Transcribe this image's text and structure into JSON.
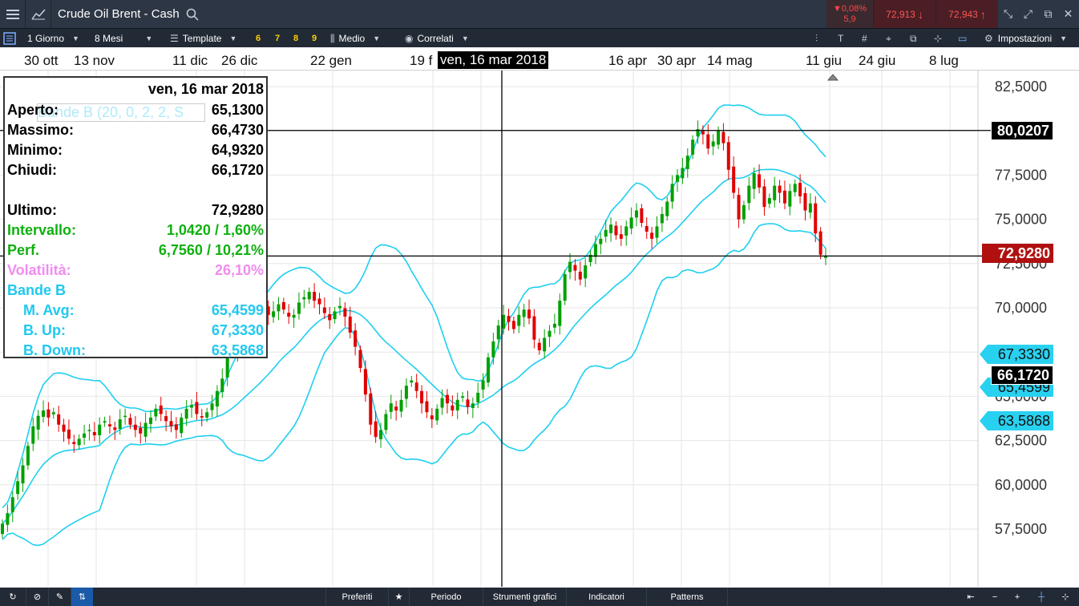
{
  "titlebar": {
    "instrument": "Crude Oil Brent - Cash",
    "change_pct": "▼0,08%",
    "change_pts": "5,9",
    "sell_price": "72,913",
    "buy_price": "72,943"
  },
  "toolbar": {
    "interval": "1 Giorno",
    "range": "8 Mesi",
    "template": "Template",
    "quick_buttons": [
      "6",
      "7",
      "8",
      "9"
    ],
    "chart_type": "Medio",
    "correlated": "Correlati",
    "settings": "Impostazioni"
  },
  "date_axis": {
    "labels": [
      "30 ott",
      "13 nov",
      "11 dic",
      "26 dic",
      "22 gen",
      "19 f",
      "16 apr",
      "30 apr",
      "14 mag",
      "11 giu",
      "24 giu",
      "8 lug"
    ],
    "cursor_date": "ven, 16 mar 2018"
  },
  "price_axis": {
    "ticks": [
      "82,5000",
      "77,5000",
      "75,0000",
      "72,5000",
      "70,0000",
      "65,0000",
      "62,5000",
      "60,0000",
      "57,5000"
    ]
  },
  "price_tags": {
    "cursor_high": "80,0207",
    "last": "72,9280",
    "band_up": "67,3330",
    "close": "66,1720",
    "mavg": "65,4599",
    "band_down": "63,5868"
  },
  "info_box": {
    "date": "ven, 16 mar 2018",
    "indicator_legend": "Bande B (20, 0, 2, 2, S",
    "open_label": "Aperto:",
    "open": "65,1300",
    "high_label": "Massimo:",
    "high": "66,4730",
    "low_label": "Minimo:",
    "low": "64,9320",
    "close_label": "Chiudi:",
    "close": "66,1720",
    "last_label": "Ultimo:",
    "last": "72,9280",
    "range_label": "Intervallo:",
    "range": "1,0420 / 1,60%",
    "perf_label": "Perf.",
    "perf": "6,7560 / 10,21%",
    "vol_label": "Volatilità:",
    "vol": "26,10%",
    "bb_label": "Bande B",
    "mavg_label": "M. Avg:",
    "mavg": "65,4599",
    "bup_label": "B. Up:",
    "bup": "67,3330",
    "bdown_label": "B. Down:",
    "bdown": "63,5868"
  },
  "bottom_bar": {
    "favorites": "Preferiti",
    "period": "Periodo",
    "tools": "Strumenti grafici",
    "indicators": "Indicatori",
    "patterns": "Patterns"
  },
  "colors": {
    "bull": "#00a000",
    "bear": "#e00000",
    "bands": "#1ecfef",
    "dark_bar": "#2d3644",
    "last_tag": "#b01010",
    "band_tag": "#29d1f0"
  },
  "chart_data": {
    "type": "candlestick",
    "ylim": [
      55.5,
      83.5
    ],
    "closes": [
      57.8,
      58.4,
      59.3,
      60.2,
      61.1,
      62.2,
      63.3,
      63.9,
      64.2,
      63.8,
      64.1,
      63.4,
      63.0,
      62.6,
      62.3,
      62.6,
      62.9,
      63.1,
      62.8,
      63.4,
      63.6,
      63.3,
      63.1,
      63.7,
      63.9,
      63.4,
      63.1,
      62.9,
      63.5,
      63.8,
      64.3,
      64.0,
      63.6,
      63.3,
      63.1,
      63.8,
      64.3,
      64.5,
      64.0,
      63.8,
      64.1,
      64.6,
      65.3,
      66.0,
      67.2,
      67.5,
      67.9,
      68.3,
      68.8,
      69.3,
      69.5,
      69.9,
      69.6,
      69.8,
      70.2,
      69.9,
      69.5,
      69.6,
      70.3,
      70.6,
      70.9,
      70.4,
      70.2,
      69.7,
      69.3,
      69.8,
      70.1,
      69.5,
      68.6,
      67.8,
      66.6,
      65.1,
      63.4,
      62.7,
      63.1,
      64.0,
      64.6,
      64.2,
      64.8,
      65.6,
      65.9,
      65.3,
      64.6,
      64.1,
      63.7,
      64.3,
      64.9,
      64.6,
      64.2,
      64.8,
      65.0,
      64.4,
      64.6,
      65.2,
      65.9,
      67.2,
      68.1,
      69.0,
      69.6,
      69.2,
      68.8,
      69.6,
      69.9,
      69.4,
      68.2,
      67.6,
      68.3,
      68.7,
      69.1,
      70.4,
      71.9,
      72.6,
      72.1,
      71.6,
      72.4,
      73.0,
      73.6,
      73.9,
      74.4,
      74.7,
      74.1,
      73.9,
      74.6,
      75.1,
      75.5,
      74.8,
      74.3,
      73.9,
      74.6,
      75.3,
      76.0,
      77.0,
      77.5,
      77.9,
      78.6,
      79.5,
      80.1,
      79.8,
      79.0,
      79.4,
      80.0,
      79.3,
      77.8,
      76.5,
      75.0,
      75.8,
      76.9,
      77.6,
      76.8,
      75.7,
      76.2,
      76.9,
      76.5,
      75.9,
      76.6,
      77.0,
      76.3,
      75.5,
      75.9,
      74.2,
      73.0,
      72.9
    ]
  }
}
